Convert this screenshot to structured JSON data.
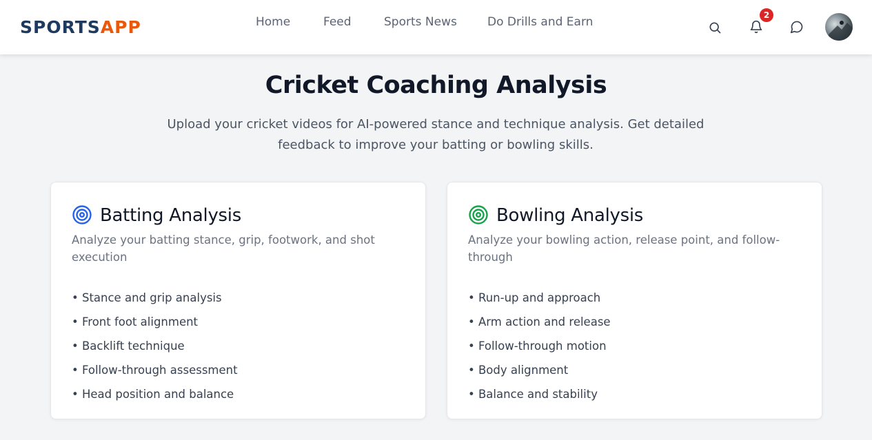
{
  "brand": {
    "part1": "SPORTS",
    "part2": "APP"
  },
  "nav": {
    "links": [
      "Home",
      "Feed",
      "Sports News",
      "Do Drills and Earn"
    ],
    "notification_count": "2"
  },
  "icons": {
    "search": "search-icon",
    "notifications": "bell-icon",
    "messages": "chat-bubble-icon",
    "avatar": "user-avatar"
  },
  "page": {
    "title": "Cricket Coaching Analysis",
    "subtitle": "Upload your cricket videos for AI-powered stance and technique analysis. Get detailed feedback to improve your batting or bowling skills."
  },
  "cards": [
    {
      "title": "Batting Analysis",
      "description": "Analyze your batting stance, grip, footwork, and shot execution",
      "icon": "target-icon",
      "accent": "#2563eb",
      "features": [
        "• Stance and grip analysis",
        "• Front foot alignment",
        "• Backlift technique",
        "• Follow-through assessment",
        "• Head position and balance"
      ]
    },
    {
      "title": "Bowling Analysis",
      "description": "Analyze your bowling action, release point, and follow-through",
      "icon": "target-icon",
      "accent": "#16a34a",
      "features": [
        "• Run-up and approach",
        "• Arm action and release",
        "• Follow-through motion",
        "• Body alignment",
        "• Balance and stability"
      ]
    }
  ],
  "colors": {
    "brand_dark": "#1f3a5f",
    "brand_orange": "#ea580c",
    "badge": "#dc2626",
    "background": "#f3f4f6"
  }
}
